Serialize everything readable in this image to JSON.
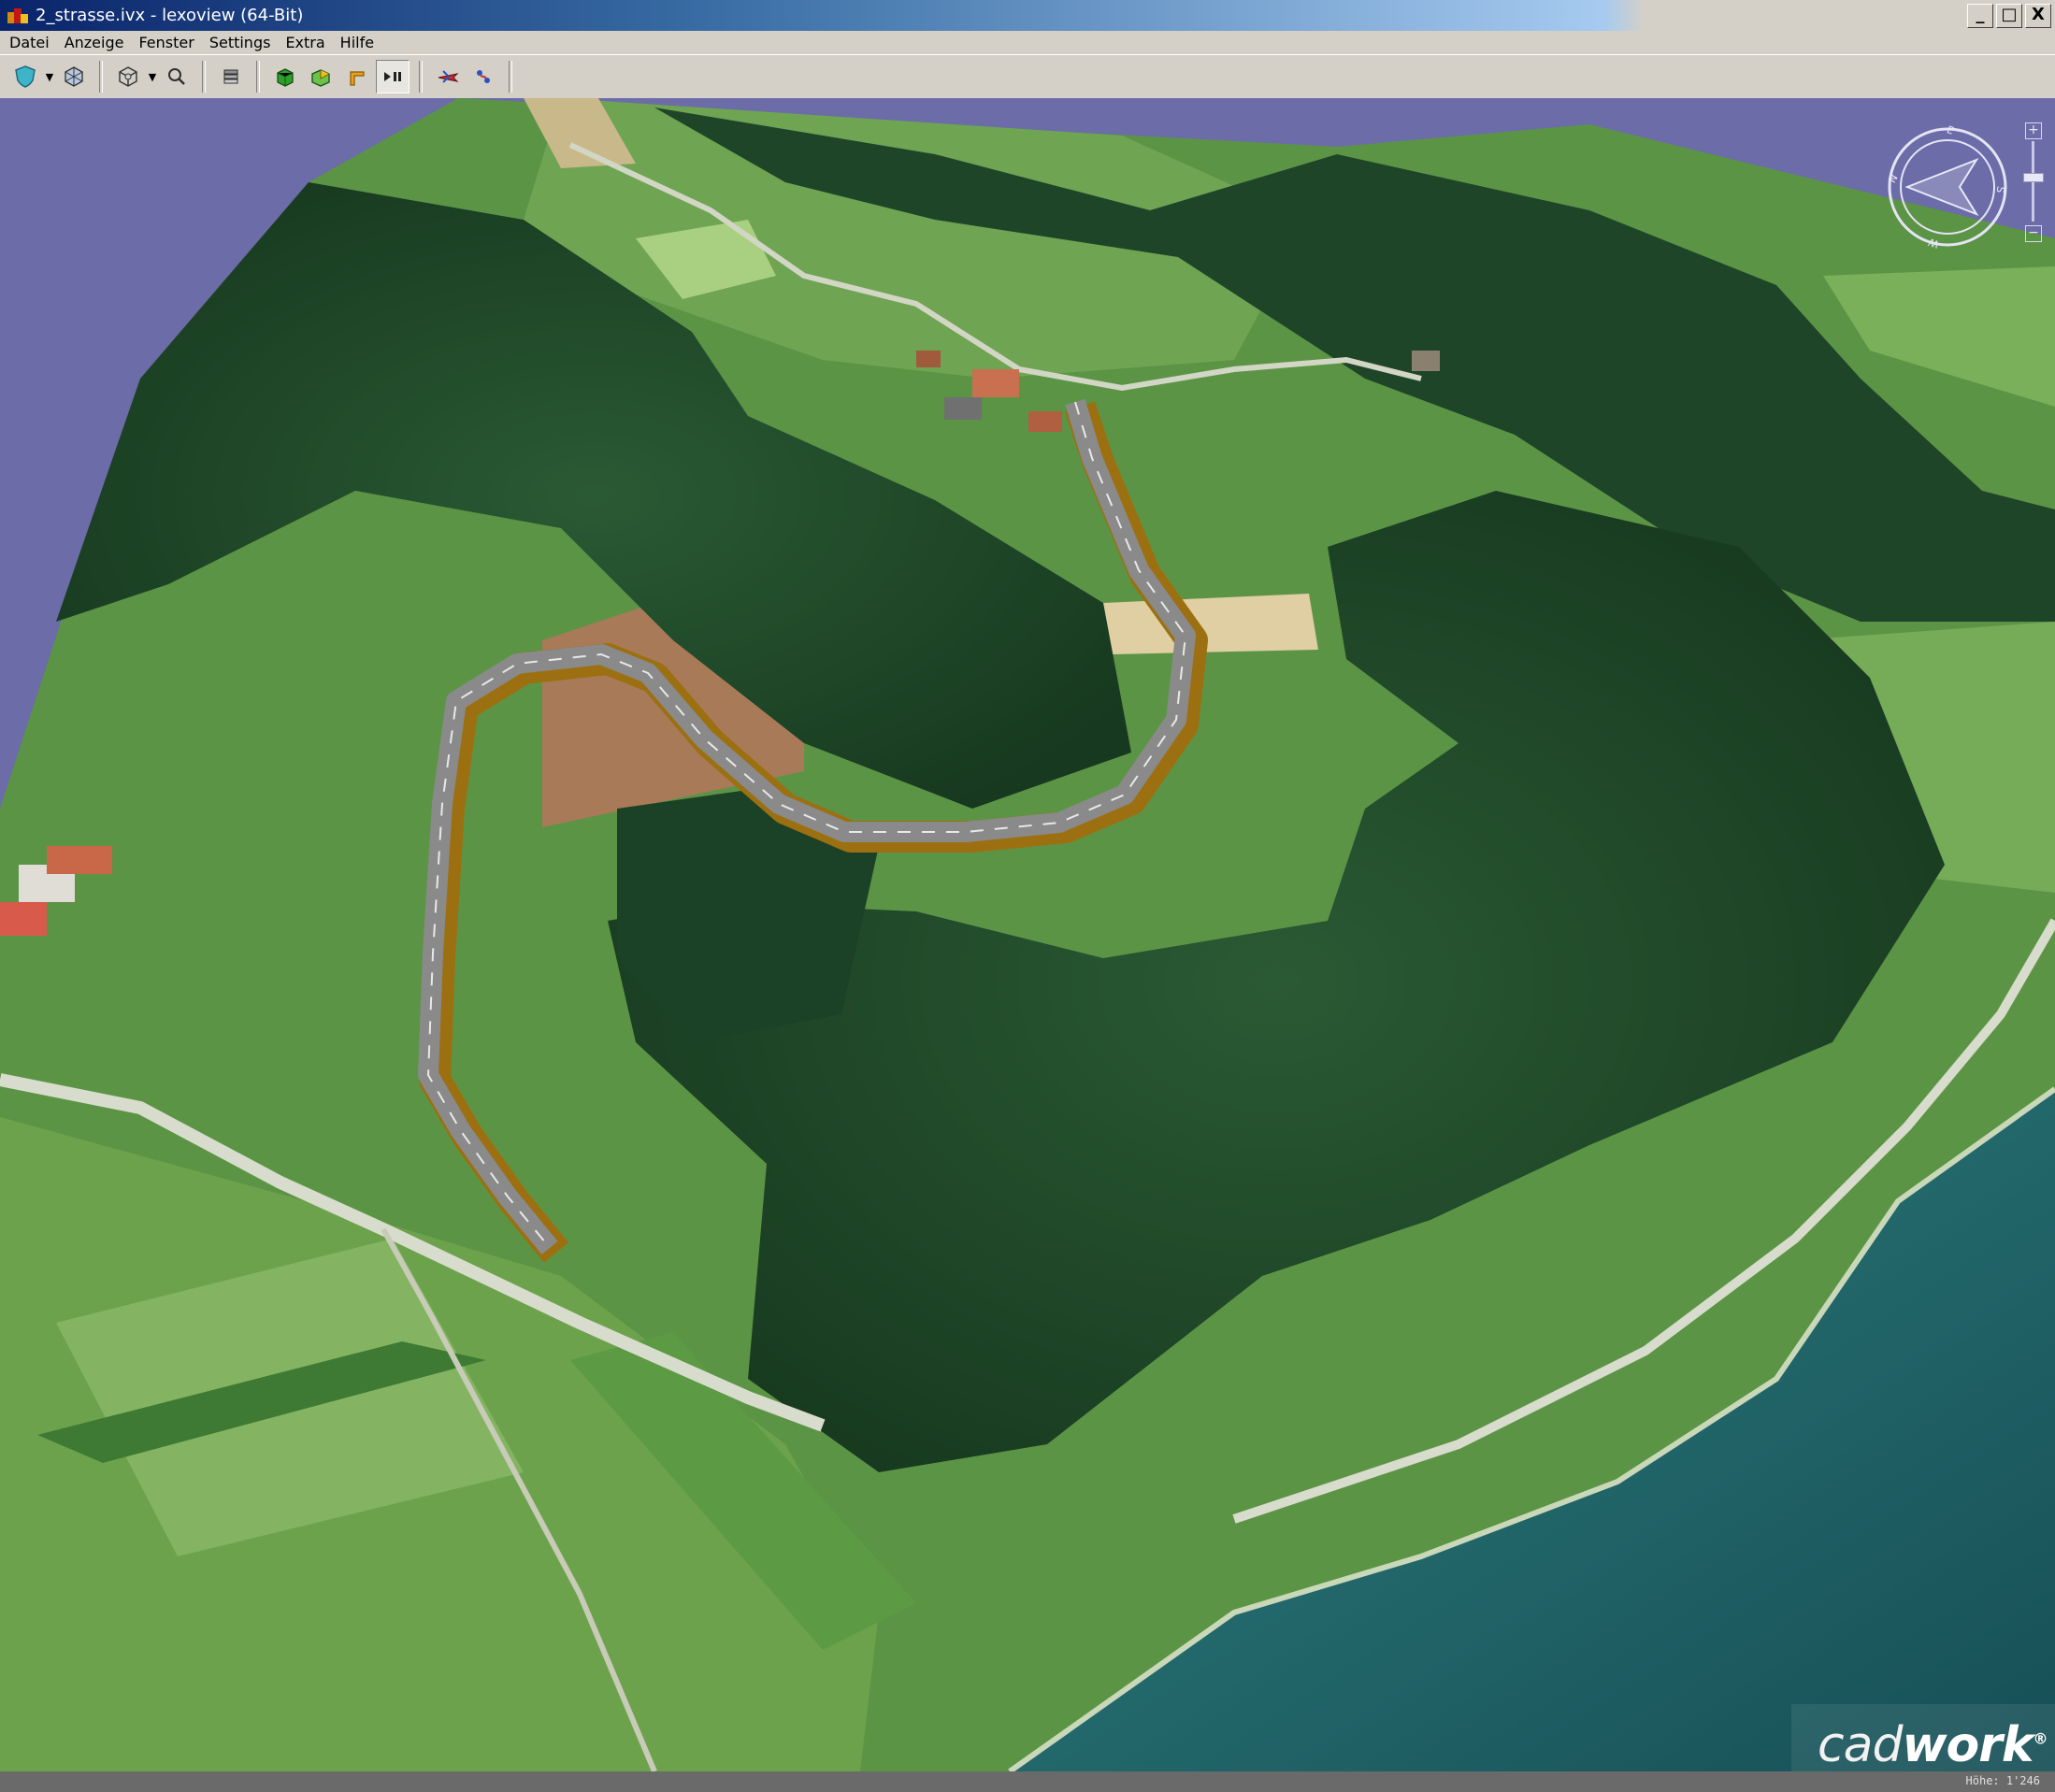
{
  "window": {
    "title": "2_strasse.ivx - lexoview (64-Bit)",
    "controls": [
      "_",
      "□",
      "X"
    ]
  },
  "menu": [
    "Datei",
    "Anzeige",
    "Fenster",
    "Settings",
    "Extra",
    "Hilfe"
  ],
  "toolbar": {
    "buttons": [
      "shield-icon",
      "view-cube-icon",
      "wireframe-cube-icon",
      "zoom-icon",
      "layers-icon",
      "green-box-icon",
      "green-open-box-icon",
      "corner-icon",
      "play-pause-icon",
      "flight-icon",
      "walk-icon"
    ],
    "pressed": "play-pause-icon"
  },
  "compass": {
    "letters": [
      "N",
      "E",
      "S",
      "W"
    ]
  },
  "zoom": {
    "plus": "+",
    "minus": "−",
    "level": 0.55
  },
  "brand": {
    "logo_part1": "cad",
    "logo_part2": "work",
    "registered": "®"
  },
  "status": {
    "height_readout": "Höhe: 1'246"
  },
  "colors": {
    "sky": "#6b6ca8",
    "meadow": "#5e9448",
    "forest": "#1f4a2c",
    "road": "#8a8a8a",
    "road_edge": "#a67a12",
    "lake": "#1f6a6e"
  }
}
